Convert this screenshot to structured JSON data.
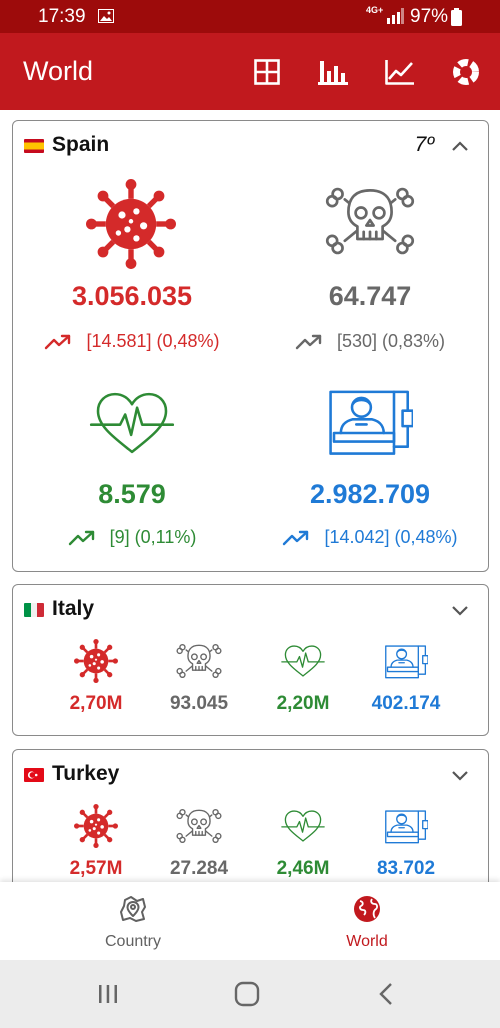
{
  "status_bar": {
    "time": "17:39",
    "network": "4G+",
    "battery": "97%"
  },
  "app_bar": {
    "title": "World",
    "actions": [
      "grid-icon",
      "bar-chart-icon",
      "line-chart-icon",
      "donut-chart-icon"
    ]
  },
  "colors": {
    "primary": "#c1191e",
    "status_bar": "#9d0b0b",
    "confirmed": "#d42a2a",
    "deaths": "#686868",
    "recovered": "#2e8b35",
    "active": "#1f7ad6"
  },
  "countries": [
    {
      "name": "Spain",
      "rank": "7º",
      "expanded": true,
      "confirmed": {
        "value": "3.056.035",
        "delta": "[14.581] (0,48%)"
      },
      "deaths": {
        "value": "64.747",
        "delta": "[530] (0,83%)"
      },
      "recovered": {
        "value": "8.579",
        "delta": "[9] (0,11%)"
      },
      "active": {
        "value": "2.982.709",
        "delta": "[14.042] (0,48%)"
      }
    },
    {
      "name": "Italy",
      "expanded": false,
      "confirmed": "2,70M",
      "deaths": "93.045",
      "recovered": "2,20M",
      "active": "402.174"
    },
    {
      "name": "Turkey",
      "expanded": false,
      "confirmed": "2,57M",
      "deaths": "27.284",
      "recovered": "2,46M",
      "active": "83.702"
    }
  ],
  "bottom_nav": [
    {
      "label": "Country",
      "icon": "map-pin-icon",
      "active": false
    },
    {
      "label": "World",
      "icon": "globe-icon",
      "active": true
    }
  ]
}
